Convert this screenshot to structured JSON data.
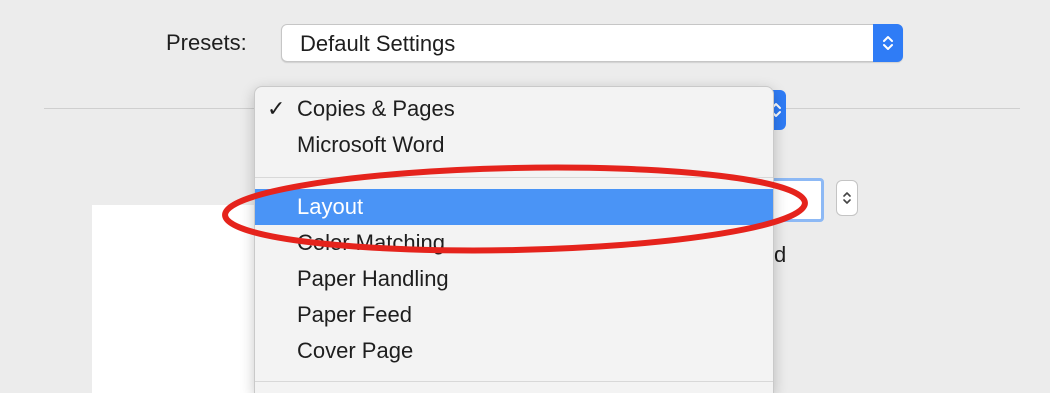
{
  "presets": {
    "label": "Presets:",
    "value": "Default Settings"
  },
  "menu": {
    "items": [
      {
        "label": "Copies & Pages",
        "checked": true,
        "check_mark": "✓"
      },
      {
        "label": "Microsoft Word"
      },
      {
        "label": "Layout",
        "highlighted": true
      },
      {
        "label": "Color Matching"
      },
      {
        "label": "Paper Handling"
      },
      {
        "label": "Paper Feed"
      },
      {
        "label": "Cover Page"
      }
    ]
  },
  "partial_text": "d",
  "colors": {
    "accent": "#2f7cf6",
    "highlight": "#4a94f6",
    "annotation": "#e5231c",
    "window_bg": "#ececec"
  }
}
